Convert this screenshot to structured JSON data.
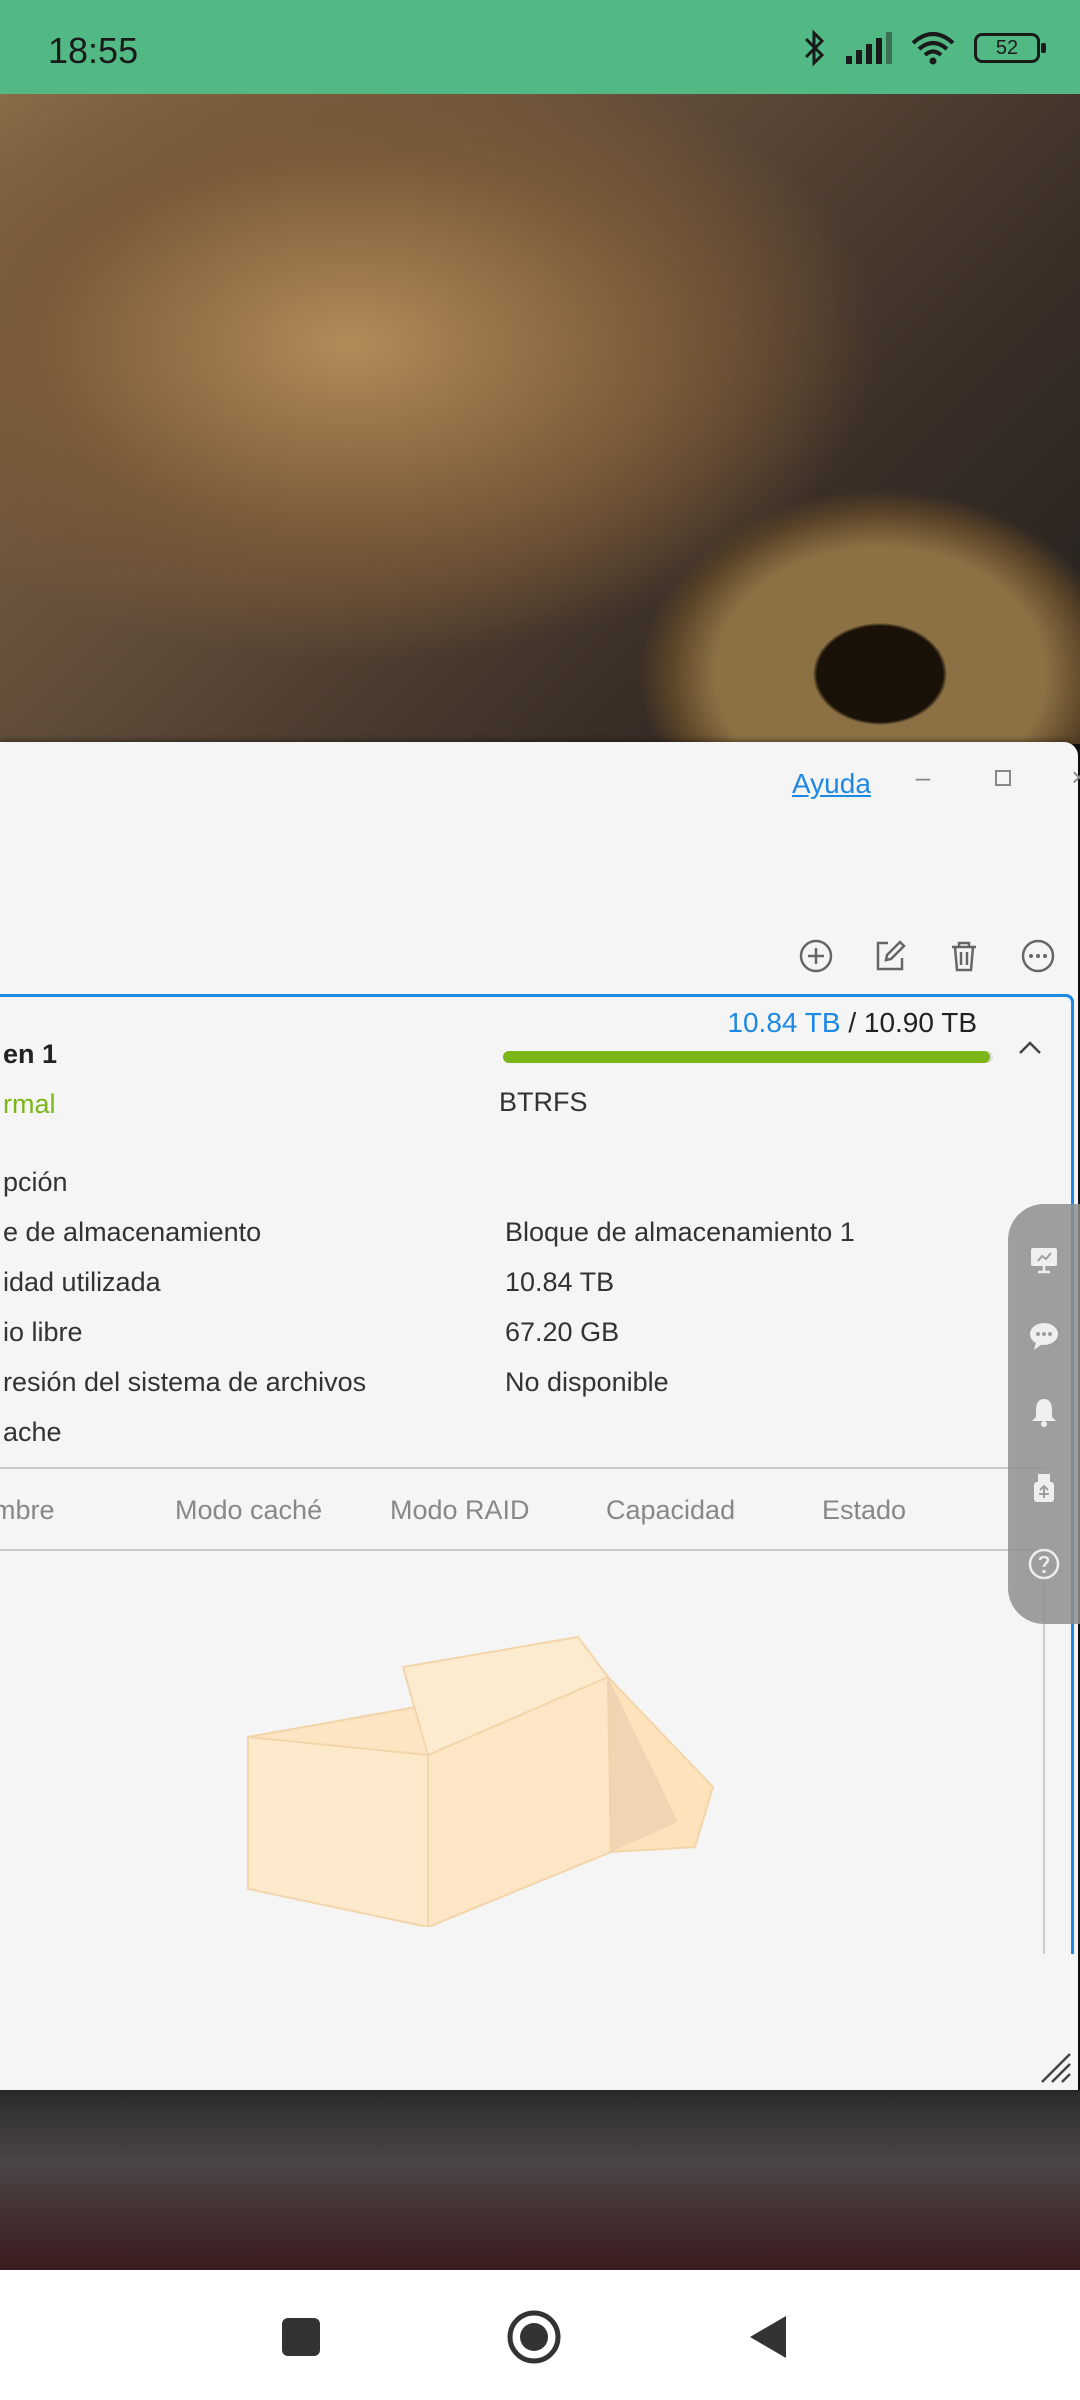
{
  "status_bar": {
    "time": "18:55",
    "battery": "52",
    "icons": [
      "bluetooth-icon",
      "signal-icon",
      "wifi-icon",
      "battery-icon"
    ]
  },
  "window": {
    "help_link": "Ayuda",
    "controls": [
      "minimize-icon",
      "maximize-icon",
      "close-icon"
    ],
    "toolbar": [
      "add-icon",
      "edit-icon",
      "delete-icon",
      "more-icon"
    ]
  },
  "volume": {
    "name": "en 1",
    "status": "rmal",
    "capacity_used": "10.84 TB",
    "capacity_separator": "/",
    "capacity_total": "10.90 TB",
    "usage_fraction": 0.9945,
    "filesystem": "BTRFS",
    "properties": [
      {
        "key": "pción",
        "value": ""
      },
      {
        "key": "e de almacenamiento",
        "value": "Bloque de almacenamiento 1"
      },
      {
        "key": "idad utilizada",
        "value": "10.84 TB"
      },
      {
        "key": "io libre",
        "value": "67.20 GB"
      },
      {
        "key": "resión del sistema de archivos",
        "value": "No disponible"
      }
    ],
    "cache_label": "ache",
    "cache_columns": [
      "mbre",
      "Modo caché",
      "Modo RAID",
      "Capacidad",
      "Estado"
    ]
  },
  "colors": {
    "status_bar": "#52b985",
    "accent_blue": "#1e88e5",
    "ok_green": "#7cb518"
  },
  "side_panel": [
    "monitor-icon",
    "chat-icon",
    "bell-icon",
    "usb-icon",
    "help-icon"
  ],
  "nav_bar": [
    "recent-apps-icon",
    "home-icon",
    "back-icon"
  ]
}
